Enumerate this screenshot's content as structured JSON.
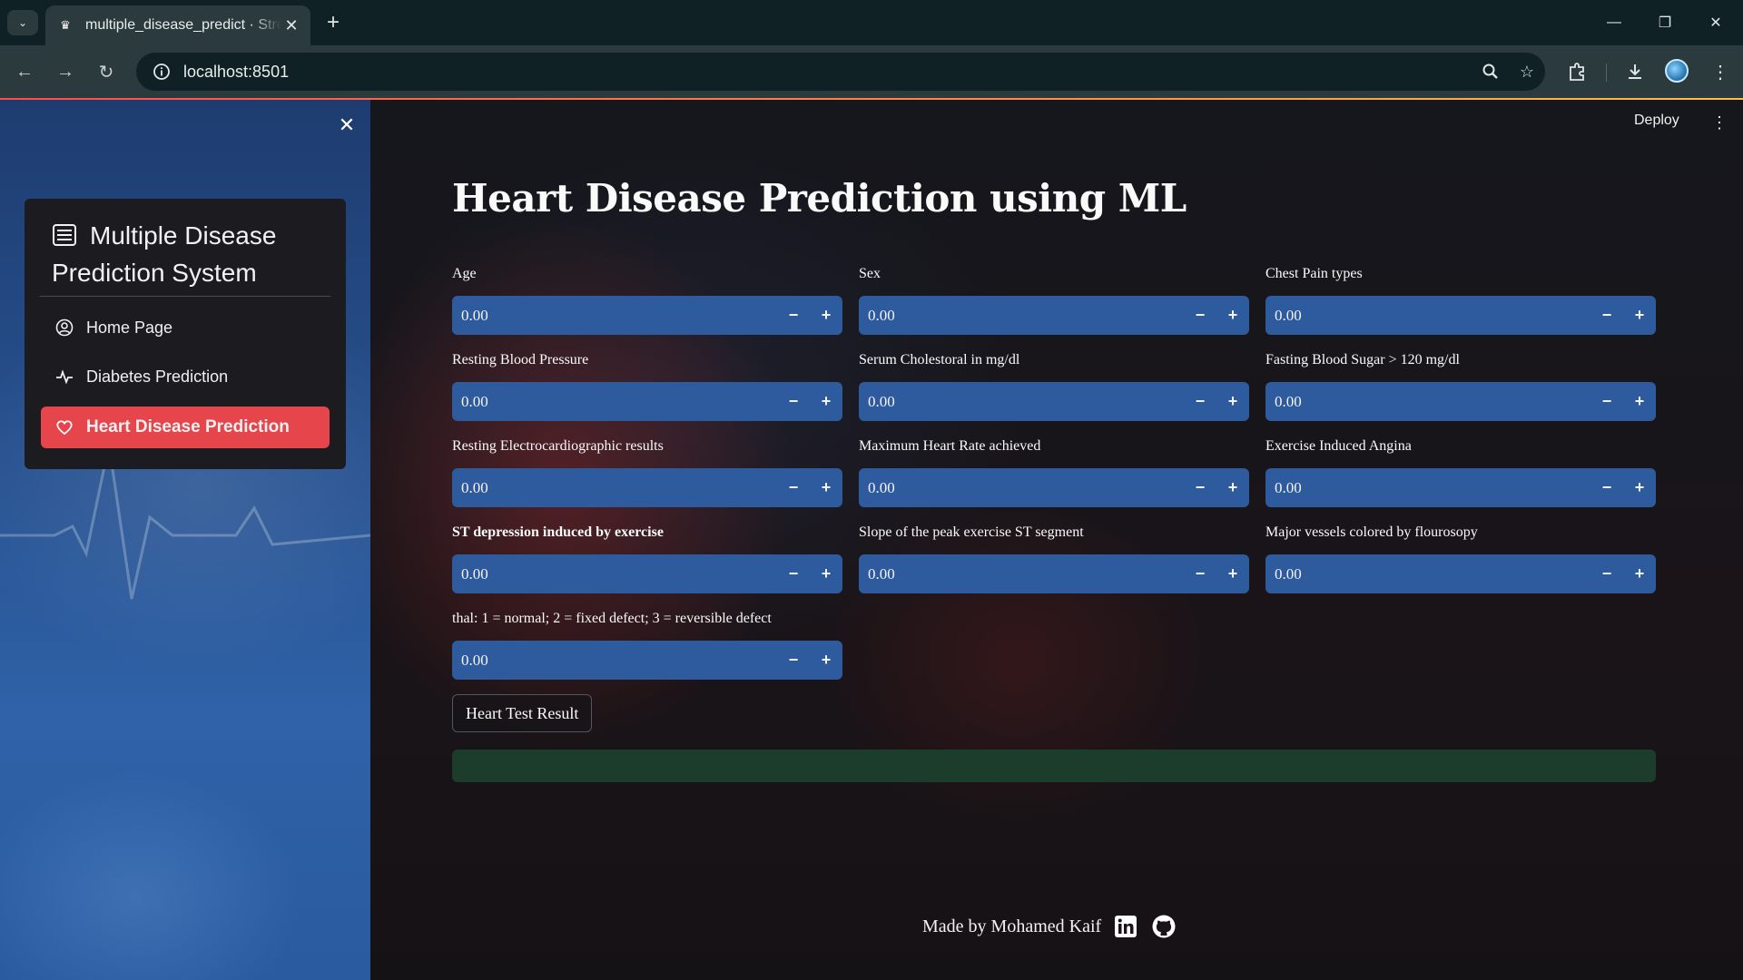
{
  "browser": {
    "tab_title": "multiple_disease_predict · Streamlit",
    "url": "localhost:8501",
    "icons": [
      "tab-search-icon",
      "close-icon",
      "plus-icon",
      "minimize-icon",
      "restore-icon",
      "close-window-icon",
      "back-icon",
      "forward-icon",
      "reload-icon",
      "info-icon",
      "zoom-icon",
      "star-icon",
      "extensions-icon",
      "download-icon",
      "profile-avatar",
      "more-icon"
    ]
  },
  "app": {
    "deploy_label": "Deploy",
    "accent": "#ff4b4b",
    "sidebar": {
      "title": "Multiple Disease Prediction System",
      "items": [
        {
          "label": "Home Page",
          "icon": "person-circle-icon",
          "active": false
        },
        {
          "label": "Diabetes Prediction",
          "icon": "activity-icon",
          "active": false
        },
        {
          "label": "Heart Disease Prediction",
          "icon": "heart-icon",
          "active": true
        }
      ],
      "active_color": "#e5454b"
    },
    "title": "Heart Disease Prediction using ML",
    "fields": [
      {
        "label": "Age",
        "value": "0.00"
      },
      {
        "label": "Sex",
        "value": "0.00"
      },
      {
        "label": "Chest Pain types",
        "value": "0.00"
      },
      {
        "label": "Resting Blood Pressure",
        "value": "0.00"
      },
      {
        "label": "Serum Cholestoral in mg/dl",
        "value": "0.00"
      },
      {
        "label": "Fasting Blood Sugar > 120 mg/dl",
        "value": "0.00"
      },
      {
        "label": "Resting Electrocardiographic results",
        "value": "0.00"
      },
      {
        "label": "Maximum Heart Rate achieved",
        "value": "0.00"
      },
      {
        "label": "Exercise Induced Angina",
        "value": "0.00"
      },
      {
        "label": "ST depression induced by exercise",
        "value": "0.00"
      },
      {
        "label": "Slope of the peak exercise ST segment",
        "value": "0.00"
      },
      {
        "label": "Major vessels colored by flourosopy",
        "value": "0.00"
      },
      {
        "label": "thal: 1 = normal; 2 = fixed defect; 3 = reversible defect",
        "value": "0.00"
      }
    ],
    "stepper": {
      "minus": "−",
      "plus": "+"
    },
    "submit_label": "Heart Test Result",
    "footer": {
      "text": "Made by Mohamed Kaif",
      "icons": [
        "linkedin-icon",
        "github-icon"
      ]
    }
  }
}
